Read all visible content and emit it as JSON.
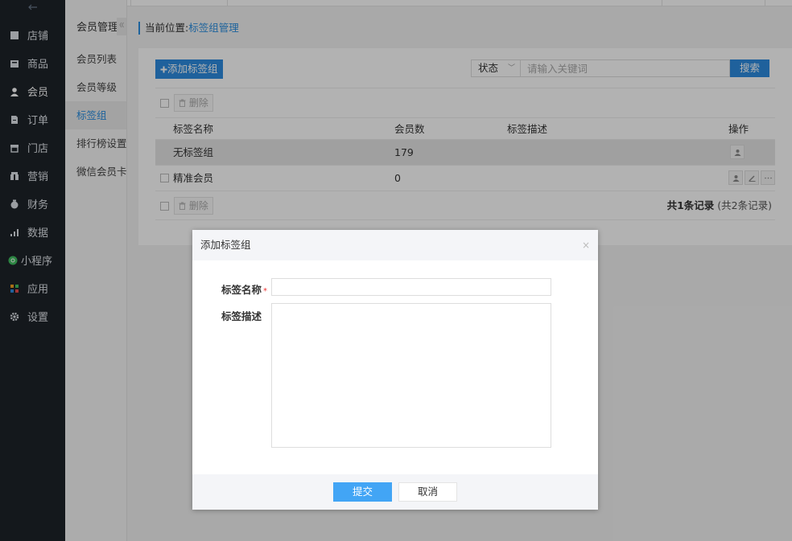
{
  "sidebar": {
    "collapse_icon": "collapse-icon",
    "items": [
      {
        "label": "店铺",
        "icon": "store-icon"
      },
      {
        "label": "商品",
        "icon": "goods-icon"
      },
      {
        "label": "会员",
        "icon": "member-icon"
      },
      {
        "label": "订单",
        "icon": "order-icon"
      },
      {
        "label": "门店",
        "icon": "shop-icon"
      },
      {
        "label": "营销",
        "icon": "marketing-icon"
      },
      {
        "label": "财务",
        "icon": "finance-icon"
      },
      {
        "label": "数据",
        "icon": "data-icon"
      },
      {
        "label": "小程序",
        "icon": "miniprogram-icon"
      },
      {
        "label": "应用",
        "icon": "apps-icon"
      },
      {
        "label": "设置",
        "icon": "settings-icon"
      }
    ]
  },
  "subnav": {
    "title": "会员管理",
    "items": [
      "会员列表",
      "会员等级",
      "标签组",
      "排行榜设置",
      "微信会员卡"
    ]
  },
  "breadcrumb": {
    "prefix": "当前位置:",
    "current": "标签组管理"
  },
  "toolbar": {
    "add_label": "添加标签组",
    "filter_label": "状态",
    "search_placeholder": "请输入关键词",
    "search_label": "搜索",
    "delete_label": "删除"
  },
  "table": {
    "headers": [
      "标签名称",
      "会员数",
      "标签描述",
      "操作"
    ],
    "rows": [
      {
        "name": "无标签组",
        "count": "179",
        "desc": ""
      },
      {
        "name": "精准会员",
        "count": "0",
        "desc": ""
      }
    ]
  },
  "footer": {
    "total": "共1条记录",
    "total_all": "(共2条记录)"
  },
  "modal": {
    "title": "添加标签组",
    "close": "×",
    "name_label": "标签名称",
    "required_mark": "*",
    "desc_label": "标签描述",
    "submit_label": "提交",
    "cancel_label": "取消"
  },
  "colors": {
    "accent": "#2d8ce0",
    "sidebar_bg": "#1e2329",
    "required": "#ee3333"
  }
}
